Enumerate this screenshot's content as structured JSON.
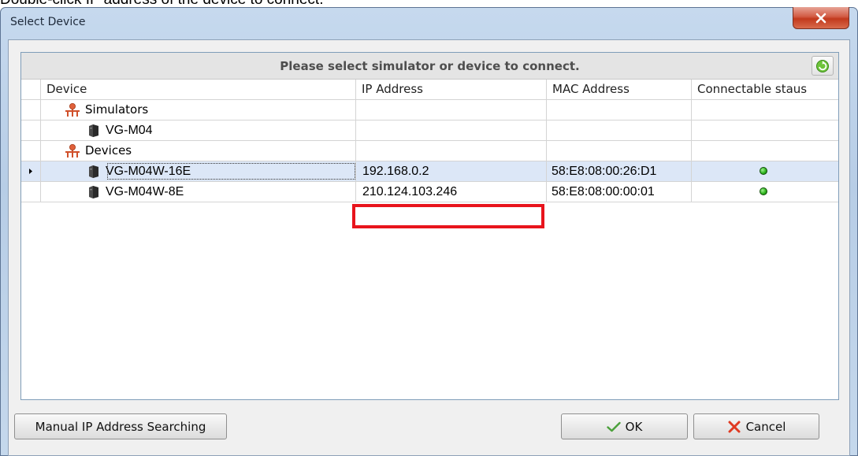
{
  "instruction": "Double-click IP address of the device to connect.",
  "window": {
    "title": "Select Device",
    "close_icon": "close-icon"
  },
  "grid": {
    "caption": "Please select simulator or device to connect.",
    "refresh_icon": "refresh-icon",
    "columns": [
      "Device",
      "IP Address",
      "MAC Address",
      "Connectable staus"
    ],
    "groups": [
      {
        "label": "Simulators",
        "icon": "network-group-icon",
        "items": [
          {
            "name": "VG-M04",
            "ip": "",
            "mac": "",
            "connectable": false,
            "icon": "device-icon"
          }
        ]
      },
      {
        "label": "Devices",
        "icon": "network-group-icon",
        "items": [
          {
            "name": "VG-M04W-16E",
            "ip": "192.168.0.2",
            "mac": "58:E8:08:00:26:D1",
            "connectable": true,
            "selected": true,
            "icon": "device-icon"
          },
          {
            "name": "VG-M04W-8E",
            "ip": "210.124.103.246",
            "mac": "58:E8:08:00:00:01",
            "connectable": true,
            "icon": "device-icon"
          }
        ]
      }
    ],
    "status_color": "#2fb51f",
    "highlight_color": "#e8141c"
  },
  "buttons": {
    "manual": "Manual IP Address Searching",
    "ok": "OK",
    "ok_icon": "checkmark-icon",
    "cancel": "Cancel",
    "cancel_icon": "x-icon"
  }
}
